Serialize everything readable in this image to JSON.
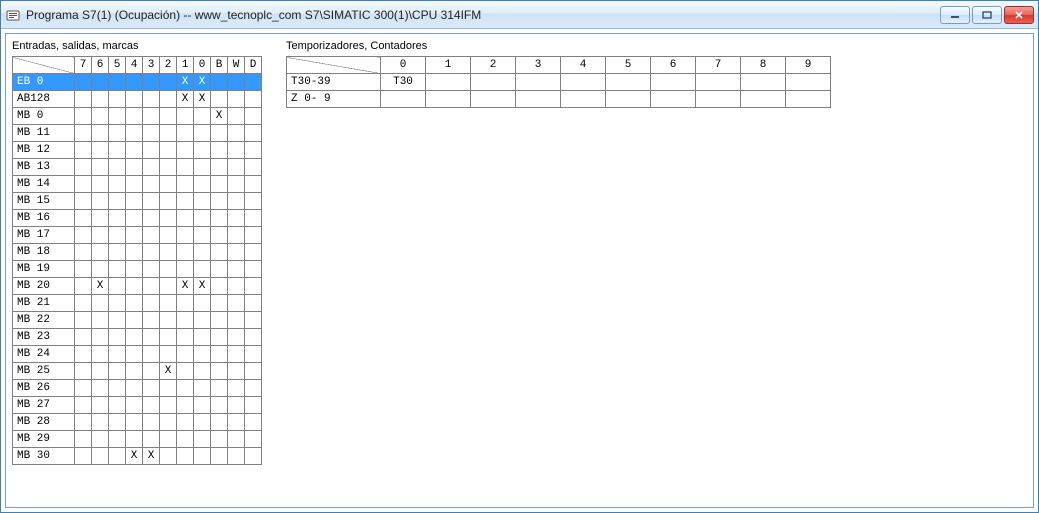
{
  "window": {
    "title": "Programa S7(1) (Ocupación) -- www_tecnoplc_com S7\\SIMATIC 300(1)\\CPU 314IFM"
  },
  "left": {
    "label": "Entradas, salidas, marcas",
    "columns": [
      "7",
      "6",
      "5",
      "4",
      "3",
      "2",
      "1",
      "0",
      "B",
      "W",
      "D"
    ],
    "rows": [
      {
        "name": "EB   0",
        "cells": [
          "",
          "",
          "",
          "",
          "",
          "",
          "X",
          "X",
          "",
          "",
          ""
        ],
        "selected": true
      },
      {
        "name": "AB128",
        "cells": [
          "",
          "",
          "",
          "",
          "",
          "",
          "X",
          "X",
          "",
          "",
          ""
        ]
      },
      {
        "name": "MB  0",
        "cells": [
          "",
          "",
          "",
          "",
          "",
          "",
          "",
          "",
          "X",
          "",
          ""
        ]
      },
      {
        "name": "MB 11",
        "cells": [
          "",
          "",
          "",
          "",
          "",
          "",
          "",
          "",
          "",
          "",
          ""
        ]
      },
      {
        "name": "MB 12",
        "cells": [
          "",
          "",
          "",
          "",
          "",
          "",
          "",
          "",
          "",
          "",
          ""
        ]
      },
      {
        "name": "MB 13",
        "cells": [
          "",
          "",
          "",
          "",
          "",
          "",
          "",
          "",
          "",
          "",
          ""
        ]
      },
      {
        "name": "MB 14",
        "cells": [
          "",
          "",
          "",
          "",
          "",
          "",
          "",
          "",
          "",
          "",
          ""
        ]
      },
      {
        "name": "MB 15",
        "cells": [
          "",
          "",
          "",
          "",
          "",
          "",
          "",
          "",
          "",
          "",
          ""
        ]
      },
      {
        "name": "MB 16",
        "cells": [
          "",
          "",
          "",
          "",
          "",
          "",
          "",
          "",
          "",
          "",
          ""
        ]
      },
      {
        "name": "MB 17",
        "cells": [
          "",
          "",
          "",
          "",
          "",
          "",
          "",
          "",
          "",
          "",
          ""
        ]
      },
      {
        "name": "MB 18",
        "cells": [
          "",
          "",
          "",
          "",
          "",
          "",
          "",
          "",
          "",
          "",
          ""
        ]
      },
      {
        "name": "MB 19",
        "cells": [
          "",
          "",
          "",
          "",
          "",
          "",
          "",
          "",
          "",
          "",
          ""
        ]
      },
      {
        "name": "MB 20",
        "cells": [
          "",
          "X",
          "",
          "",
          "",
          "",
          "X",
          "X",
          "",
          "",
          ""
        ]
      },
      {
        "name": "MB 21",
        "cells": [
          "",
          "",
          "",
          "",
          "",
          "",
          "",
          "",
          "",
          "",
          ""
        ]
      },
      {
        "name": "MB 22",
        "cells": [
          "",
          "",
          "",
          "",
          "",
          "",
          "",
          "",
          "",
          "",
          ""
        ]
      },
      {
        "name": "MB 23",
        "cells": [
          "",
          "",
          "",
          "",
          "",
          "",
          "",
          "",
          "",
          "",
          ""
        ]
      },
      {
        "name": "MB 24",
        "cells": [
          "",
          "",
          "",
          "",
          "",
          "",
          "",
          "",
          "",
          "",
          ""
        ]
      },
      {
        "name": "MB 25",
        "cells": [
          "",
          "",
          "",
          "",
          "",
          "X",
          "",
          "",
          "",
          "",
          ""
        ]
      },
      {
        "name": "MB 26",
        "cells": [
          "",
          "",
          "",
          "",
          "",
          "",
          "",
          "",
          "",
          "",
          ""
        ]
      },
      {
        "name": "MB 27",
        "cells": [
          "",
          "",
          "",
          "",
          "",
          "",
          "",
          "",
          "",
          "",
          ""
        ]
      },
      {
        "name": "MB 28",
        "cells": [
          "",
          "",
          "",
          "",
          "",
          "",
          "",
          "",
          "",
          "",
          ""
        ]
      },
      {
        "name": "MB 29",
        "cells": [
          "",
          "",
          "",
          "",
          "",
          "",
          "",
          "",
          "",
          "",
          ""
        ]
      },
      {
        "name": "MB 30",
        "cells": [
          "",
          "",
          "",
          "X",
          "X",
          "",
          "",
          "",
          "",
          "",
          ""
        ]
      }
    ]
  },
  "right": {
    "label": "Temporizadores, Contadores",
    "columns": [
      "0",
      "1",
      "2",
      "3",
      "4",
      "5",
      "6",
      "7",
      "8",
      "9"
    ],
    "rows": [
      {
        "name": "T30-39",
        "cells": [
          "T30",
          "",
          "",
          "",
          "",
          "",
          "",
          "",
          "",
          ""
        ]
      },
      {
        "name": "Z 0- 9",
        "cells": [
          "",
          "",
          "",
          "",
          "",
          "",
          "",
          "",
          "",
          ""
        ]
      }
    ]
  }
}
